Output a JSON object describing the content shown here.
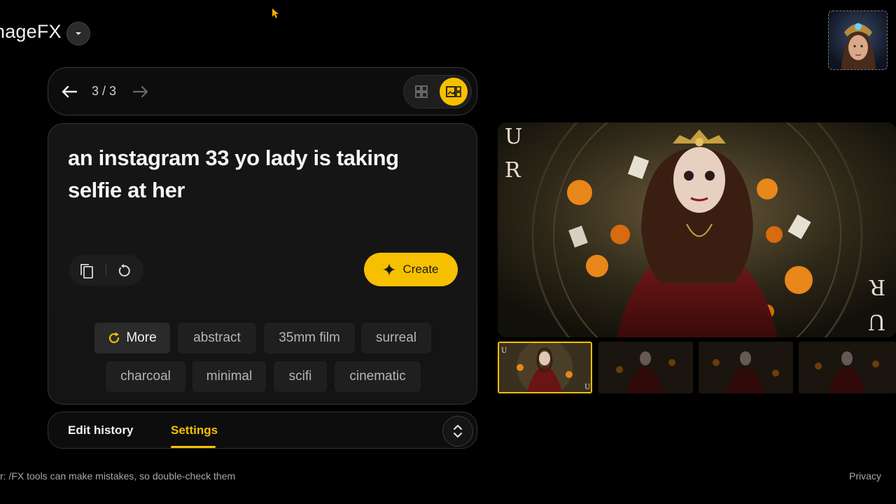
{
  "header": {
    "app_title": "nageFX"
  },
  "navigation": {
    "page_counter": "3 / 3"
  },
  "prompt": {
    "line1": "an instagram 33 yo lady is taking",
    "line2": "selfie at her"
  },
  "actions": {
    "create_label": "Create"
  },
  "chips": {
    "more": "More",
    "items": [
      "abstract",
      "35mm film",
      "surreal",
      "charcoal",
      "minimal",
      "scifi",
      "cinematic"
    ]
  },
  "tabs": {
    "edit_history": "Edit history",
    "settings": "Settings"
  },
  "footer": {
    "disclaimer": "r: /FX tools can make mistakes, so double-check them",
    "privacy": "Privacy"
  },
  "colors": {
    "accent": "#f6c000",
    "background": "#000000",
    "card": "#151515"
  },
  "icons": [
    "chevron-down-icon",
    "arrow-left-icon",
    "arrow-right-icon",
    "grid-view-icon",
    "single-view-icon",
    "copy-icon",
    "reset-icon",
    "sparkle-icon",
    "refresh-icon",
    "expand-collapse-icon"
  ]
}
